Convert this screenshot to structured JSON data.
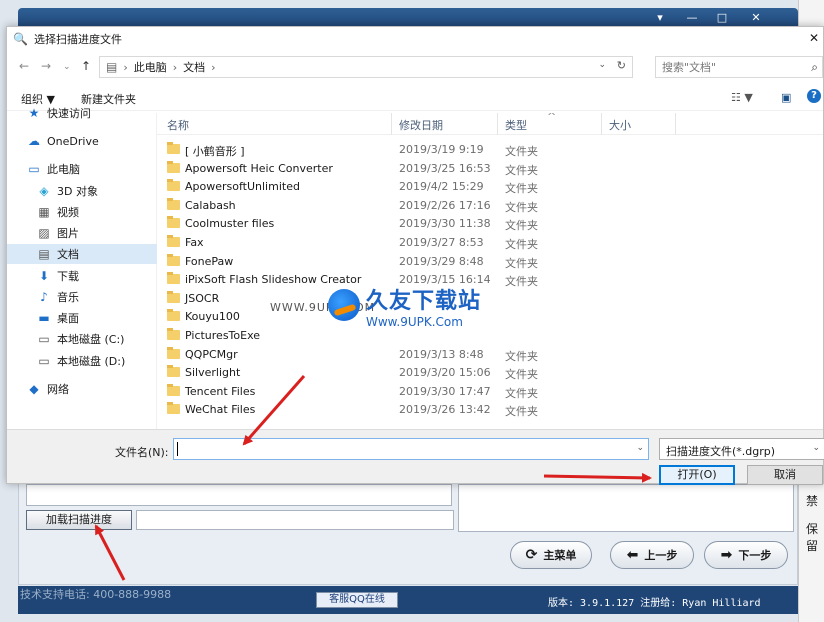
{
  "background_app": {
    "load_button_label": "加载扫描进度",
    "main_menu_label": "主菜单",
    "prev_label": "上一步",
    "next_label": "下一步",
    "support_text": "技术支持电话: 400-888-9988",
    "qq_label": "客服QQ在线",
    "version_text": "版本: 3.9.1.127 注册给:  Ryan Hilliard",
    "right_strip_texts": [
      "禁",
      "保留"
    ]
  },
  "dialog": {
    "title": "选择扫描进度文件",
    "breadcrumb": [
      "此电脑",
      "文档"
    ],
    "search_placeholder": "搜索\"文档\"",
    "toolbar": {
      "organize": "组织 ▼",
      "new_folder": "新建文件夹"
    },
    "nav_items": [
      {
        "label": "快速访问",
        "icon": "star-icon"
      },
      {
        "label": "OneDrive",
        "icon": "cloud-icon"
      },
      {
        "label": "此电脑",
        "icon": "computer-icon"
      },
      {
        "label": "3D 对象",
        "icon": "cube-icon"
      },
      {
        "label": "视频",
        "icon": "video-icon"
      },
      {
        "label": "图片",
        "icon": "image-icon"
      },
      {
        "label": "文档",
        "icon": "document-icon"
      },
      {
        "label": "下载",
        "icon": "download-icon"
      },
      {
        "label": "音乐",
        "icon": "music-icon"
      },
      {
        "label": "桌面",
        "icon": "desktop-icon"
      },
      {
        "label": "本地磁盘 (C:)",
        "icon": "drive-icon"
      },
      {
        "label": "本地磁盘 (D:)",
        "icon": "drive-icon"
      },
      {
        "label": "网络",
        "icon": "network-icon"
      }
    ],
    "columns": {
      "name": "名称",
      "date": "修改日期",
      "type": "类型",
      "size": "大小"
    },
    "files": [
      {
        "name": "[ 小鹤音形 ]",
        "date": "2019/3/19 9:19",
        "type": "文件夹"
      },
      {
        "name": "Apowersoft Heic Converter",
        "date": "2019/3/25 16:53",
        "type": "文件夹"
      },
      {
        "name": "ApowersoftUnlimited",
        "date": "2019/4/2 15:29",
        "type": "文件夹"
      },
      {
        "name": "Calabash",
        "date": "2019/2/26 17:16",
        "type": "文件夹"
      },
      {
        "name": "Coolmuster files",
        "date": "2019/3/30 11:38",
        "type": "文件夹"
      },
      {
        "name": "Fax",
        "date": "2019/3/27 8:53",
        "type": "文件夹"
      },
      {
        "name": "FonePaw",
        "date": "2019/3/29 8:48",
        "type": "文件夹"
      },
      {
        "name": "iPixSoft Flash Slideshow Creator",
        "date": "2019/3/15 16:14",
        "type": "文件夹"
      },
      {
        "name": "JSOCR",
        "date": "",
        "type": ""
      },
      {
        "name": "Kouyu100",
        "date": "",
        "type": ""
      },
      {
        "name": "PicturesToExe",
        "date": "",
        "type": ""
      },
      {
        "name": "QQPCMgr",
        "date": "2019/3/13 8:48",
        "type": "文件夹"
      },
      {
        "name": "Silverlight",
        "date": "2019/3/20 15:06",
        "type": "文件夹"
      },
      {
        "name": "Tencent Files",
        "date": "2019/3/30 17:47",
        "type": "文件夹"
      },
      {
        "name": "WeChat Files",
        "date": "2019/3/26 13:42",
        "type": "文件夹"
      }
    ],
    "filename_label": "文件名(N):",
    "filename_value": "",
    "filetype_value": "扫描进度文件(*.dgrp)",
    "open_label": "打开(O)",
    "cancel_label": "取消"
  },
  "watermark": {
    "url_left": "WWW.9UPK.COM",
    "title": "久友下载站",
    "url": "Www.9UPK.Com"
  },
  "colors": {
    "accent": "#0078d7",
    "arrow": "#d9201e",
    "title_bar": "#1e4576"
  }
}
